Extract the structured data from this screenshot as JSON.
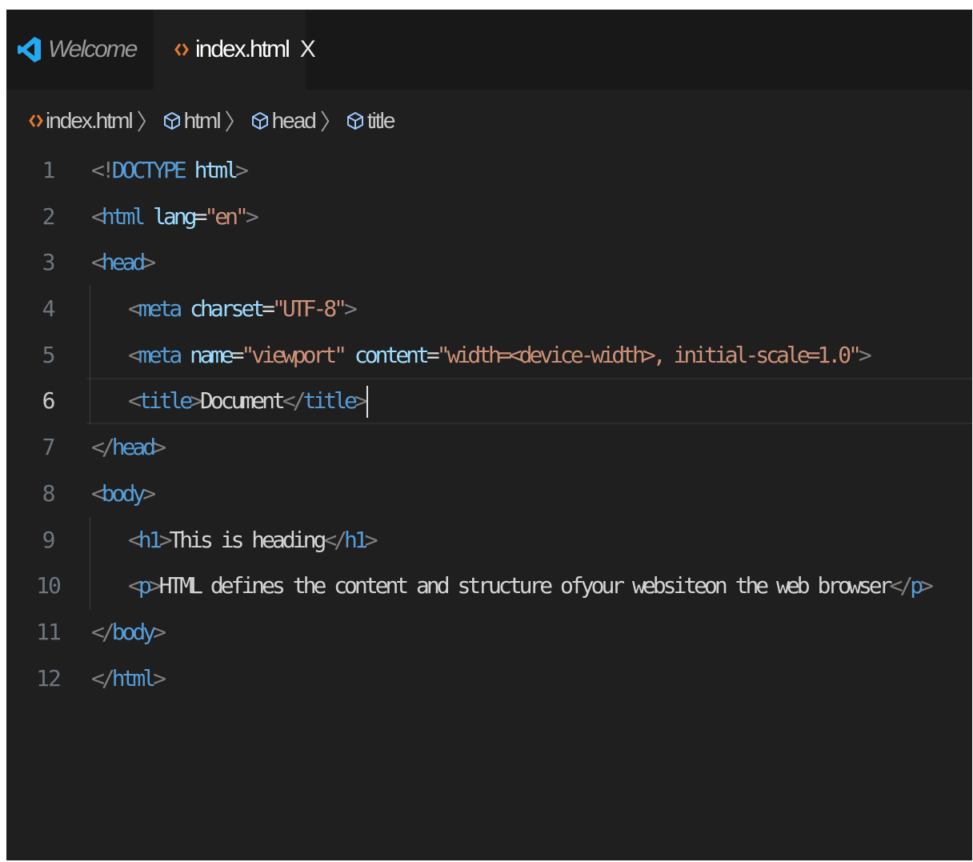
{
  "tabs": [
    {
      "label": "Welcome",
      "icon": "vscode-logo-icon",
      "active": false
    },
    {
      "label": "index.html",
      "icon": "html-file-icon",
      "active": true,
      "close_glyph": "X"
    }
  ],
  "breadcrumb": [
    {
      "label": "index.html",
      "icon": "html-file-icon"
    },
    {
      "label": "html",
      "icon": "symbol-element-icon"
    },
    {
      "label": "head",
      "icon": "symbol-element-icon"
    },
    {
      "label": "title",
      "icon": "symbol-element-icon"
    }
  ],
  "breadcrumb_separator": "〉",
  "editor": {
    "active_line": 6,
    "lines": [
      {
        "number": "1",
        "text": "<!DOCTYPE html>"
      },
      {
        "number": "2",
        "text": "<html lang=\"en\">"
      },
      {
        "number": "3",
        "text": "<head>"
      },
      {
        "number": "4",
        "text": "<meta charset=\"UTF-8\">"
      },
      {
        "number": "5",
        "text": "<meta name=\"viewport\" content=\"width=<device-width>, initial-scale=1.0\">"
      },
      {
        "number": "6",
        "text": "<title>Document</title>"
      },
      {
        "number": "7",
        "text": "</head>"
      },
      {
        "number": "8",
        "text": "<body>"
      },
      {
        "number": "9",
        "text": "<h1>This is heading</h1>"
      },
      {
        "number": "10",
        "text": "<p>HTML defines the content and structure ofyour websiteon the web browser</p>"
      },
      {
        "number": "11",
        "text": "</body>"
      },
      {
        "number": "12",
        "text": "</html>"
      }
    ]
  },
  "colors": {
    "editor_background": "#1f1f1f",
    "tab_bar_background": "#181818",
    "tag": "#569cd6",
    "attribute": "#9cdcfe",
    "string": "#ce9178",
    "punctuation": "#808080",
    "text": "#d4d4d4",
    "html_icon": "#e37933",
    "vscode_logo": "#23a9f2"
  }
}
